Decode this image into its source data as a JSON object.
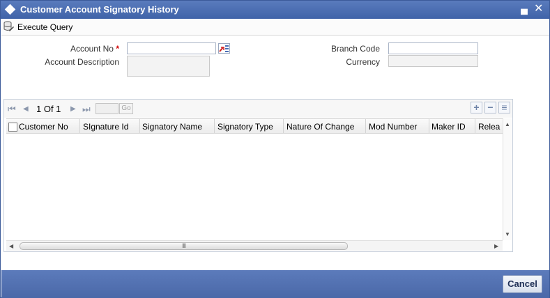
{
  "window": {
    "title": "Customer Account Signatory History",
    "minimize_glyph": "▄",
    "close_glyph": "✕"
  },
  "toolbar": {
    "execute_query_label": "Execute Query",
    "icon": "database-query-icon"
  },
  "form": {
    "account_no_label": "Account No",
    "required_marker": "*",
    "account_no_value": "",
    "account_description_label": "Account Description",
    "account_description_value": "",
    "branch_code_label": "Branch Code",
    "branch_code_value": "",
    "currency_label": "Currency",
    "currency_value": ""
  },
  "grid": {
    "pager": {
      "first_glyph": "⏮",
      "prev_glyph": "◀",
      "next_glyph": "▶",
      "last_glyph": "⏭",
      "page_text": "1 Of 1",
      "page_input": "",
      "go_label": "Go"
    },
    "actions": {
      "add_glyph": "+",
      "delete_glyph": "−",
      "view_glyph": "≡"
    },
    "columns": [
      "Customer No",
      "SIgnature Id",
      "Signatory Name",
      "Signatory Type",
      "Nature Of Change",
      "Mod Number",
      "Maker ID",
      "Relea"
    ],
    "rows": [],
    "scroll_thumb_text": "III"
  },
  "footer": {
    "cancel_label": "Cancel"
  },
  "colors": {
    "title_bar": "#3f63a8",
    "footer": "#4a68a8",
    "required": "#d00000"
  }
}
